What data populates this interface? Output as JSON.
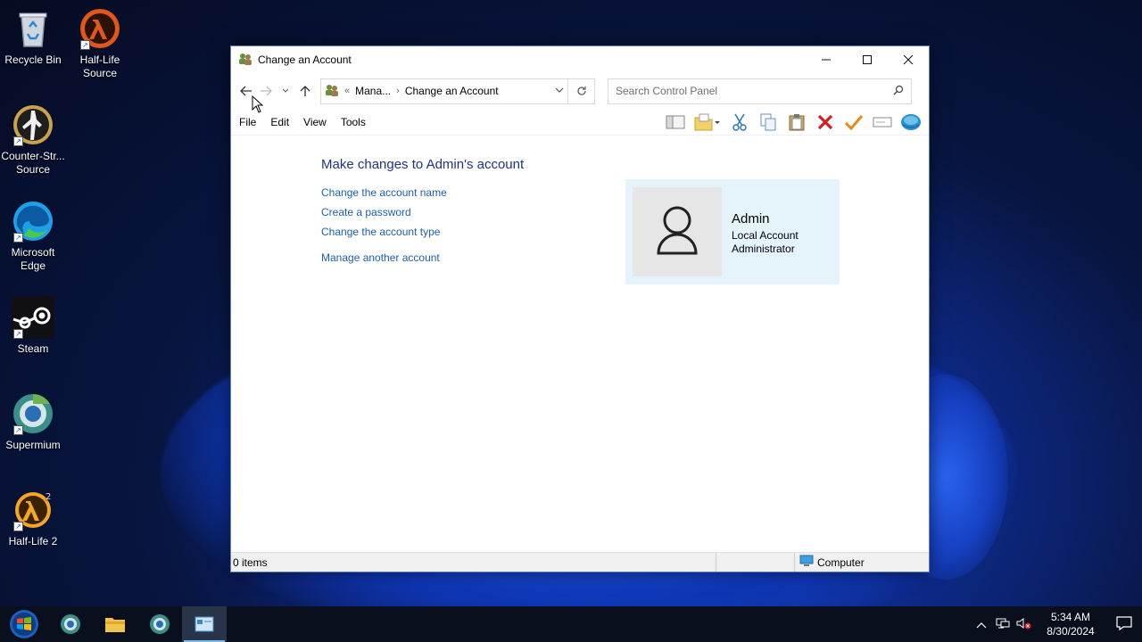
{
  "desktop": {
    "icons": [
      {
        "label": "Recycle Bin",
        "icon": "recycle-bin-icon"
      },
      {
        "label": "Half-Life Source",
        "icon": "half-life-source-icon"
      },
      {
        "label": "Counter-Str... Source",
        "icon": "counter-strike-icon"
      },
      {
        "label": "Microsoft Edge",
        "icon": "edge-icon"
      },
      {
        "label": "Steam",
        "icon": "steam-icon"
      },
      {
        "label": "Supermium",
        "icon": "supermium-icon"
      },
      {
        "label": "Half-Life 2",
        "icon": "half-life-2-icon"
      }
    ]
  },
  "window": {
    "title": "Change an Account",
    "address": {
      "prefix": "«",
      "crumbs": [
        "Mana...",
        "Change an Account"
      ]
    },
    "search_placeholder": "Search Control Panel",
    "menu": [
      "File",
      "Edit",
      "View",
      "Tools"
    ],
    "heading": "Make changes to Admin's account",
    "tasks": [
      "Change the account name",
      "Create a password",
      "Change the account type",
      "Manage another account"
    ],
    "account": {
      "name": "Admin",
      "type": "Local Account",
      "role": "Administrator"
    },
    "status": {
      "items": "0 items",
      "location": "Computer"
    }
  },
  "taskbar": {
    "time": "5:34 AM",
    "date": "8/30/2024"
  },
  "colors": {
    "link": "#1a5fb4",
    "heading": "#1e3287",
    "card_bg": "#e5f3fb",
    "taskbar": "#0a0f1e"
  }
}
